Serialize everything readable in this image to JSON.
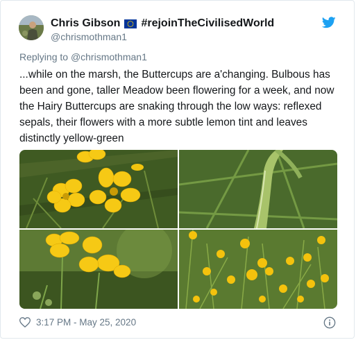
{
  "user": {
    "display_name": "Chris Gibson",
    "flag_icon": "eu-flag-icon",
    "hashtag": "#rejoinTheCivilisedWorld",
    "handle": "@chrismothman1"
  },
  "reply": {
    "prefix": "Replying to ",
    "target": "@chrismothman1"
  },
  "tweet": {
    "text": "...while on the marsh, the Buttercups are a'changing. Bulbous has been and gone, taller Meadow been flowering for a week, and now the Hairy Buttercups are snaking through the low ways: reflexed sepals, their flowers with a more subtle lemon tint and leaves distinctly yellow-green"
  },
  "photos": [
    {
      "name": "photo-buttercup-flowers-closeup"
    },
    {
      "name": "photo-hairy-stem"
    },
    {
      "name": "photo-buttercup-flower-side"
    },
    {
      "name": "photo-buttercup-patch"
    }
  ],
  "footer": {
    "time": "3:17 PM - May 25, 2020"
  },
  "colors": {
    "brand": "#1da1f2",
    "text": "#14171a",
    "muted": "#657786"
  }
}
